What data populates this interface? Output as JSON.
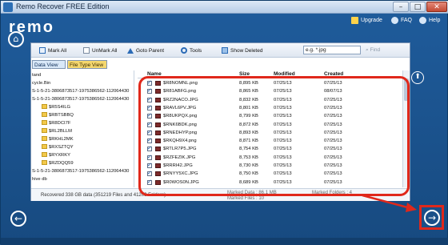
{
  "window": {
    "title": "Remo Recover FREE Edition",
    "minimize": "–",
    "maximize": "□",
    "close": "✕"
  },
  "header": {
    "logo": "remo",
    "links": [
      {
        "label": "Upgrade"
      },
      {
        "label": "FAQ"
      },
      {
        "label": "Help"
      }
    ]
  },
  "toolbar": {
    "mark_all": "Mark All",
    "unmark_all": "UnMark All",
    "goto_parent": "Goto Parent",
    "tools": "Tools",
    "show_deleted": "Show Deleted",
    "search_value": "e.g. *.jpg",
    "find": "Find"
  },
  "tabs": {
    "data_view": "Data View",
    "file_type_view": "File Type View"
  },
  "tree": [
    "tand",
    "cycle.Bin",
    "S-1-5-21-3806873517-1975386562-112064430",
    "S-1-5-21-3806873517-1975386562-112064430",
    "$R5S4ILG",
    "$RBTSBBQ",
    "$R8DCI7F",
    "$RL2BLLM",
    "$RKHL2MK",
    "$RXSZTQY",
    "$RYXRKY",
    "$RZDQQ59",
    "S-1-5-21-3806873517-1975386562-112064430",
    "hive db"
  ],
  "table": {
    "headers": {
      "name": "Name",
      "size": "Size",
      "modified": "Modified",
      "created": "Created"
    },
    "rows": [
      {
        "name": "$R8NOMNL.png",
        "size": "8,895 KB",
        "modified": "07/25/13",
        "created": "07/25/13"
      },
      {
        "name": "$R81ABFG.png",
        "size": "8,865 KB",
        "modified": "07/25/13",
        "created": "08/07/13"
      },
      {
        "name": "$RZ2NACO.JPG",
        "size": "8,832 KB",
        "modified": "07/25/13",
        "created": "07/25/13"
      },
      {
        "name": "$RAVL6PV.JPG",
        "size": "8,801 KB",
        "modified": "07/25/13",
        "created": "07/25/13"
      },
      {
        "name": "$R8UKPQX.png",
        "size": "8,799 KB",
        "modified": "07/25/13",
        "created": "07/25/13"
      },
      {
        "name": "$RNK6BDK.png",
        "size": "8,872 KB",
        "modified": "07/25/13",
        "created": "07/25/13"
      },
      {
        "name": "$RNEDHYP.png",
        "size": "8,893 KB",
        "modified": "07/25/13",
        "created": "07/25/13"
      },
      {
        "name": "$RKQH9X4.png",
        "size": "8,871 KB",
        "modified": "07/25/13",
        "created": "07/25/13"
      },
      {
        "name": "$RTLR7P5.JPG",
        "size": "8,754 KB",
        "modified": "07/25/13",
        "created": "07/25/13"
      },
      {
        "name": "$RZFEZIK.JPG",
        "size": "8,753 KB",
        "modified": "07/25/13",
        "created": "07/25/13"
      },
      {
        "name": "$RRRI42.JPG",
        "size": "8,730 KB",
        "modified": "07/25/13",
        "created": "07/25/13"
      },
      {
        "name": "$RNYY5XC.JPG",
        "size": "8,750 KB",
        "modified": "07/25/13",
        "created": "07/25/13"
      },
      {
        "name": "$R0WOS0N.JPG",
        "size": "8,689 KB",
        "modified": "07/25/13",
        "created": "07/25/13"
      }
    ]
  },
  "status": {
    "recovered": "Recovered 338 GB data (351219 Files and 41209 Folders)",
    "marked_data": "Marked Data : 86.1 MB",
    "marked_files": "Marked Files : 10",
    "marked_folders": "Marked Folders : 4"
  },
  "nav": {
    "back": "←",
    "next": "→",
    "side": "⬆",
    "home": "⌂"
  },
  "colors": {
    "highlight": "#e0281b",
    "background": "#1b4e86"
  }
}
